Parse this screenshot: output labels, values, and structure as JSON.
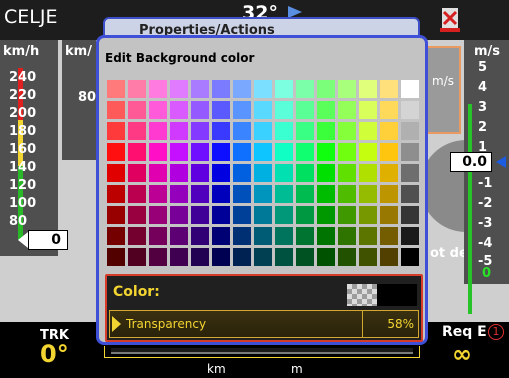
{
  "header": {
    "location": "CELJE",
    "wind_speed": "32°",
    "wind_arrow_icon": "wind-direction-arrow"
  },
  "left_tape": {
    "unit": "km/h",
    "labels": [
      "240",
      "220",
      "200",
      "180",
      "160",
      "140",
      "120",
      "100",
      "80"
    ],
    "current_value": "0"
  },
  "left_tape_2": {
    "unit": "km/",
    "value": "80"
  },
  "right_tape": {
    "unit": "m/s",
    "labels": [
      "5",
      "4",
      "3",
      "2",
      "1",
      "-1",
      "-2",
      "-3",
      "-4",
      "-5"
    ],
    "current_value": "0.0",
    "bottom_value": "0",
    "mps_card": "m/s",
    "status": "ot dete"
  },
  "under_dialog": {
    "title": "Properties/Actions"
  },
  "dialog": {
    "title": "Edit Background color",
    "color_label": "Color:",
    "transparency_label": "Transparency",
    "transparency_value": "58%"
  },
  "palette_rows": [
    [
      "#ff7b7b",
      "#ff7ba8",
      "#ff7be0",
      "#e07bff",
      "#a87bff",
      "#7b7bff",
      "#7ba8ff",
      "#7be0ff",
      "#7bffe0",
      "#7bffa8",
      "#7bff7b",
      "#a8ff7b",
      "#e0ff7b",
      "#ffe07b",
      "#ffffff"
    ],
    [
      "#ff5a5a",
      "#ff5a95",
      "#ff5ad9",
      "#d95aff",
      "#955aff",
      "#5a5aff",
      "#5a95ff",
      "#5ad9ff",
      "#5affd9",
      "#5aff95",
      "#5aff5a",
      "#95ff5a",
      "#d9ff5a",
      "#ffd95a",
      "#d4d4d4"
    ],
    [
      "#ff3a3a",
      "#ff3a85",
      "#ff3ad0",
      "#d03aff",
      "#853aff",
      "#3a3aff",
      "#3a85ff",
      "#3ad0ff",
      "#3affd0",
      "#3aff85",
      "#3aff3a",
      "#85ff3a",
      "#d0ff3a",
      "#ffd03a",
      "#b0b0b0"
    ],
    [
      "#ff0f0f",
      "#ff0f70",
      "#ff0fc5",
      "#c50fff",
      "#700fff",
      "#0f0fff",
      "#0f70ff",
      "#0fc5ff",
      "#0fffc5",
      "#0fff70",
      "#0fff0f",
      "#70ff0f",
      "#c5ff0f",
      "#ffc50f",
      "#8e8e8e"
    ],
    [
      "#e00000",
      "#e00060",
      "#e000b0",
      "#b000e0",
      "#6000e0",
      "#0000e0",
      "#0060e0",
      "#00b0e0",
      "#00e0b0",
      "#00e060",
      "#00e000",
      "#60e000",
      "#b0e000",
      "#e0b000",
      "#6e6e6e"
    ],
    [
      "#bc0000",
      "#bc0050",
      "#bc0095",
      "#9500bc",
      "#5000bc",
      "#0000bc",
      "#0050bc",
      "#0095bc",
      "#00bc95",
      "#00bc50",
      "#00bc00",
      "#50bc00",
      "#95bc00",
      "#bc9500",
      "#505050"
    ],
    [
      "#980000",
      "#980040",
      "#980078",
      "#780098",
      "#400098",
      "#000098",
      "#004098",
      "#007898",
      "#009878",
      "#009840",
      "#009800",
      "#409800",
      "#789800",
      "#987800",
      "#353535"
    ],
    [
      "#740000",
      "#740030",
      "#74005c",
      "#5c0074",
      "#300074",
      "#000074",
      "#003074",
      "#005c74",
      "#00745c",
      "#007430",
      "#007400",
      "#307400",
      "#5c7400",
      "#745c00",
      "#1a1a1a"
    ],
    [
      "#520000",
      "#520022",
      "#520040",
      "#400052",
      "#220052",
      "#000052",
      "#002252",
      "#004052",
      "#005240",
      "#005222",
      "#005200",
      "#225200",
      "#405200",
      "#524000",
      "#000000"
    ]
  ],
  "footer": {
    "trk_label": "TRK",
    "trk_value": "0°",
    "reqe_label": "Req E",
    "reqe_value": "∞",
    "reqe_badge": "①",
    "scale_km": "km",
    "scale_m": "m"
  }
}
